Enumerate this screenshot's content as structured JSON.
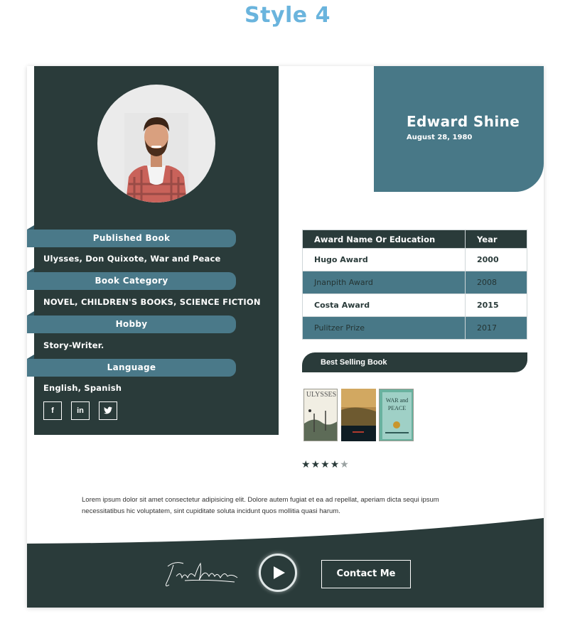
{
  "page": {
    "style_title": "Style 4"
  },
  "profile": {
    "name": "Edward Shine",
    "dob": "August 28, 1980"
  },
  "sections": [
    {
      "label": "Published Book",
      "value": "Ulysses, Don Quixote, War and Peace"
    },
    {
      "label": "Book Category",
      "value": "NOVEL, CHILDREN'S BOOKS, SCIENCE FICTION"
    },
    {
      "label": "Hobby",
      "value": "Story-Writer."
    },
    {
      "label": "Language",
      "value": "English, Spanish"
    }
  ],
  "social": [
    {
      "icon": "facebook-icon",
      "glyph": "f"
    },
    {
      "icon": "linkedin-icon",
      "glyph": "in"
    },
    {
      "icon": "twitter-icon",
      "glyph": "🐦"
    }
  ],
  "awards": {
    "headers": [
      "Award Name Or Education",
      "Year"
    ],
    "rows": [
      [
        "Hugo Award",
        "2000"
      ],
      [
        "Jnanpith Award",
        "2008"
      ],
      [
        "Costa Award",
        "2015"
      ],
      [
        "Pulitzer Prize",
        "2017"
      ]
    ]
  },
  "best_selling": {
    "label": "Best Selling Book",
    "books": [
      {
        "title": "ULYSSES"
      },
      {
        "title": ""
      },
      {
        "title": "WAR and PEACE"
      }
    ]
  },
  "rating": {
    "value": 4,
    "max": 5
  },
  "bio": "Lorem ipsum dolor sit amet consectetur adipisicing elit. Dolore autem fugiat et ea ad repellat, aperiam dicta sequi ipsum necessitatibus hic voluptatem, sint cupiditate soluta incidunt quos mollitia quasi harum.",
  "footer": {
    "signature": "Frank Sinatra",
    "contact_label": "Contact Me"
  },
  "colors": {
    "dark": "#2a3b3a",
    "accent": "#487887",
    "title_blue": "#6ab4dd"
  }
}
